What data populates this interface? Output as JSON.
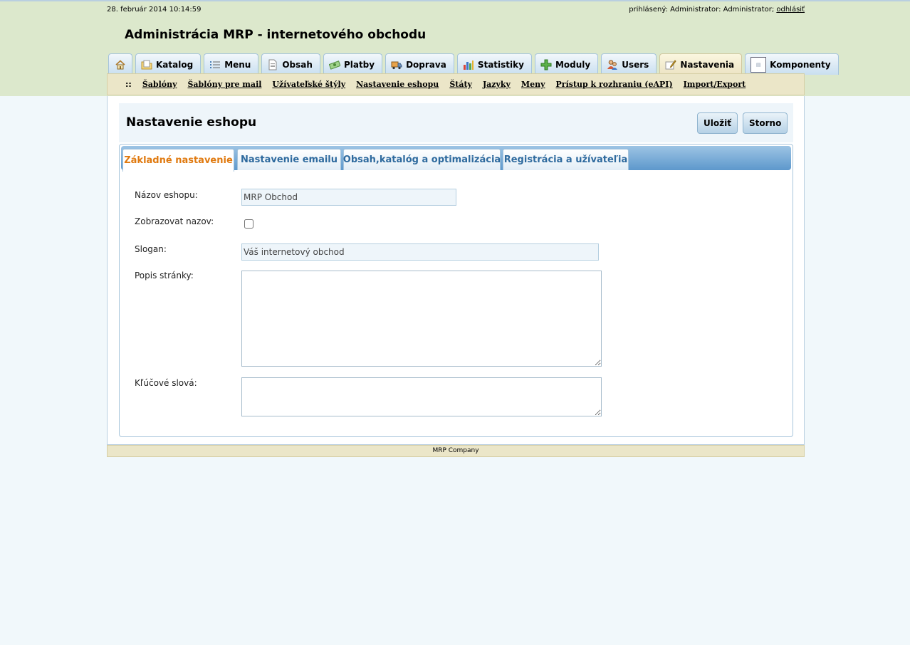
{
  "topbar": {
    "datetime": "28. február 2014 10:14:59",
    "logged_text": "prihlásený: Administrator: Administrator;",
    "logout_label": "odhlásiť"
  },
  "app_title": "Administrácia MRP - internetového obchodu",
  "main_tabs": [
    {
      "label": "",
      "icon": "home-icon"
    },
    {
      "label": "Katalog",
      "icon": "folder-icon"
    },
    {
      "label": "Menu",
      "icon": "list-icon"
    },
    {
      "label": "Obsah",
      "icon": "document-icon"
    },
    {
      "label": "Platby",
      "icon": "money-icon"
    },
    {
      "label": "Doprava",
      "icon": "truck-icon"
    },
    {
      "label": "Statistiky",
      "icon": "bar-chart-icon"
    },
    {
      "label": "Moduly",
      "icon": "plus-icon"
    },
    {
      "label": "Users",
      "icon": "users-icon"
    },
    {
      "label": "Nastavenia",
      "icon": "settings-note-icon",
      "active": true
    },
    {
      "label": "Komponenty",
      "icon": "component-icon"
    }
  ],
  "subnav": {
    "separator": "::",
    "links": [
      "Šablóny",
      "Šablóny pre mail",
      "Užívateľské štýly",
      "Nastavenie eshopu",
      "Štáty",
      "Jazyky",
      "Meny",
      "Prístup k rozhraniu (eAPI)",
      "Import/Export"
    ]
  },
  "page": {
    "title": "Nastavenie eshopu",
    "save_label": "Uložiť",
    "cancel_label": "Storno"
  },
  "form_tabs": [
    {
      "label": "Základné nastavenie",
      "active": true
    },
    {
      "label": "Nastavenie emailu"
    },
    {
      "label": "Obsah,katalóg a optimalizácia"
    },
    {
      "label": "Registrácia a užívateľia"
    }
  ],
  "form": {
    "shop_name_label": "Názov eshopu:",
    "shop_name_value": "MRP Obchod",
    "show_name_label": "Zobrazovat nazov:",
    "show_name_checked": false,
    "slogan_label": "Slogan:",
    "slogan_value": "Váš internetový obchod",
    "description_label": "Popis stránky:",
    "description_value": "",
    "keywords_label": "Kľúčové slová:",
    "keywords_value": ""
  },
  "footer": "MRP Company"
}
